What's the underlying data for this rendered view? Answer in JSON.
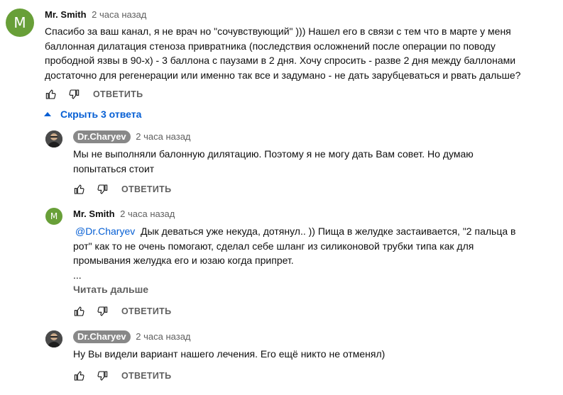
{
  "comments": [
    {
      "avatar_letter": "M",
      "author": "Mr. Smith",
      "time": "2 часа назад",
      "lines": [
        "Спасибо за ваш канал, я не врач но \"сочувствующий\" ))) Нашел его в связи с тем что в марте у меня",
        "баллонная дилатация стеноза привратника (последствия осложнений после операции по поводу",
        "прободной язвы в 90-х) - 3 баллона с паузами в 2 дня. Хочу спросить - разве 2 дня между баллонами",
        "достаточно для регенерации или именно так все и задумано - не дать зарубцеваться и рвать дальше?"
      ],
      "reply_label": "ОТВЕТИТЬ"
    }
  ],
  "replies_toggle": "Скрыть 3 ответа",
  "replies": [
    {
      "author": "Dr.Charyev",
      "time": "2 часа назад",
      "lines": [
        "Мы не выполняли балонную дилятацию. Поэтому я не могу дать Вам совет. Но думаю",
        "попытаться стоит"
      ],
      "reply_label": "ОТВЕТИТЬ"
    },
    {
      "avatar_letter": "M",
      "author": "Mr. Smith",
      "time": "2 часа назад",
      "mention": "@Dr.Charyev",
      "line1_rest": "  Дык деваться уже некуда, дотянул.. )) Пища в желудке застаивается, \"2 пальца в",
      "lines": [
        "рот\" как то не очень помогают, сделал себе шланг из силиконовой трубки типа как для",
        "промывания желудка его и юзаю когда припрет.",
        "..."
      ],
      "read_more": "Читать дальше",
      "reply_label": "ОТВЕТИТЬ"
    },
    {
      "author": "Dr.Charyev",
      "time": "2 часа назад",
      "lines": [
        "Ну Вы видели вариант нашего лечения. Его ещё никто не отменял)"
      ],
      "reply_label": "ОТВЕТИТЬ"
    }
  ],
  "icons": {
    "like": "thumb-up-icon",
    "dislike": "thumb-down-icon",
    "toggle": "caret-up-icon"
  }
}
